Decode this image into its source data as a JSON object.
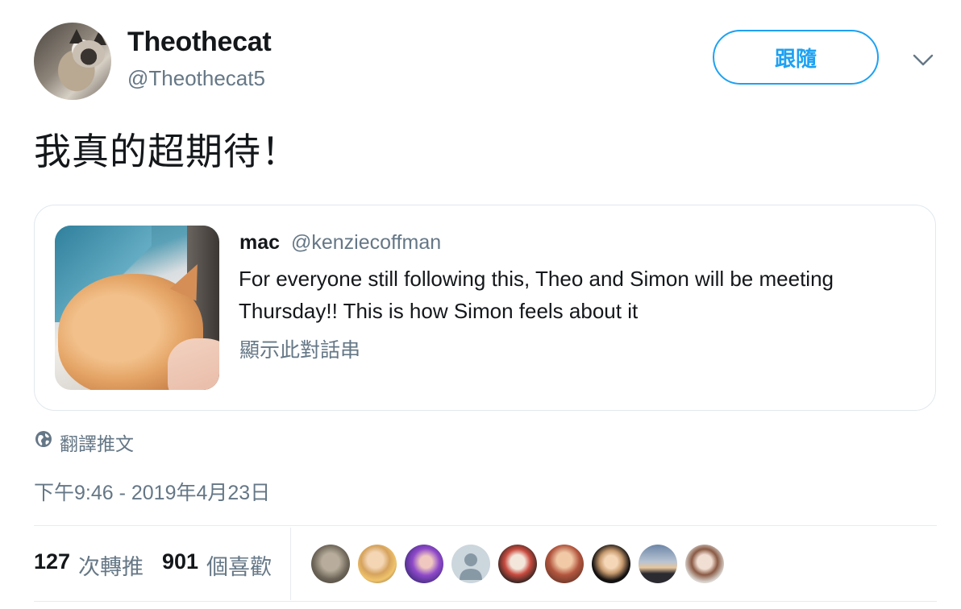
{
  "author": {
    "display_name": "Theothecat",
    "handle": "@Theothecat5"
  },
  "follow_button": {
    "label": "跟隨"
  },
  "tweet": {
    "text": "我真的超期待！"
  },
  "quoted_tweet": {
    "name": "mac",
    "handle": "@kenziecoffman",
    "text": "For everyone still following this, Theo and Simon will be meeting Thursday!! This is how Simon feels about it",
    "show_thread": "顯示此對話串"
  },
  "translate": {
    "label": "翻譯推文",
    "icon": "globe-icon"
  },
  "timestamp": "下午9:46 - 2019年4月23日",
  "stats": {
    "retweets_count": "127",
    "retweets_label": "次轉推",
    "likes_count": "901",
    "likes_label": "個喜歡"
  },
  "colors": {
    "accent": "#1da1f2",
    "text": "#14171a",
    "muted": "#657786",
    "border": "#e1e8ed"
  }
}
